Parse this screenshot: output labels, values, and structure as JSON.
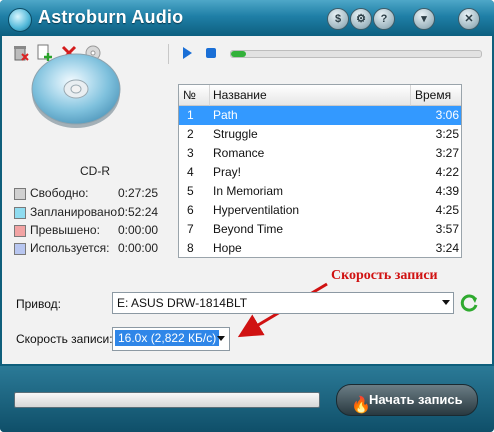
{
  "window": {
    "title": "Astroburn Audio"
  },
  "titlebar_buttons": [
    {
      "name": "skins-button",
      "glyph": "$"
    },
    {
      "name": "settings-button",
      "glyph": "⚙"
    },
    {
      "name": "help-button",
      "glyph": "?"
    },
    {
      "name": "minimize-button",
      "glyph": "▾"
    },
    {
      "name": "close-button",
      "glyph": "✕"
    }
  ],
  "toolbar": {
    "icons": [
      "erase-disc-icon",
      "add-files-icon",
      "remove-icon",
      "disc-info-icon",
      "play-icon",
      "stop-icon"
    ],
    "playback_progress": 0.06
  },
  "disc": {
    "type_label": "CD-R",
    "stats": [
      {
        "label": "Свободно:",
        "value": "0:27:25",
        "color": "#d0d0d0"
      },
      {
        "label": "Запланировано:",
        "value": "0:52:24",
        "color": "#8fdcf0"
      },
      {
        "label": "Превышено:",
        "value": "0:00:00",
        "color": "#f2a3a3"
      },
      {
        "label": "Используется:",
        "value": "0:00:00",
        "color": "#b8c6f0"
      }
    ]
  },
  "tracklist": {
    "columns": {
      "num": "№",
      "title": "Название",
      "time": "Время"
    },
    "rows": [
      {
        "num": "1",
        "title": "Path",
        "time": "3:06",
        "selected": true
      },
      {
        "num": "2",
        "title": "Struggle",
        "time": "3:25"
      },
      {
        "num": "3",
        "title": "Romance",
        "time": "3:27"
      },
      {
        "num": "4",
        "title": "Pray!",
        "time": "4:22"
      },
      {
        "num": "5",
        "title": "In Memoriam",
        "time": "4:39"
      },
      {
        "num": "6",
        "title": "Hyperventilation",
        "time": "4:25"
      },
      {
        "num": "7",
        "title": "Beyond Time",
        "time": "3:57"
      },
      {
        "num": "8",
        "title": "Hope",
        "time": "3:24"
      }
    ]
  },
  "drive": {
    "label": "Привод:",
    "value": "E: ASUS DRW-1814BLT"
  },
  "speed": {
    "label": "Скорость записи:",
    "value": "16.0x (2,822 КБ/с)"
  },
  "annotation": {
    "text": "Скорость записи",
    "color": "#d01212"
  },
  "footer": {
    "start_label": "Начать запись",
    "burn_progress": 0
  }
}
